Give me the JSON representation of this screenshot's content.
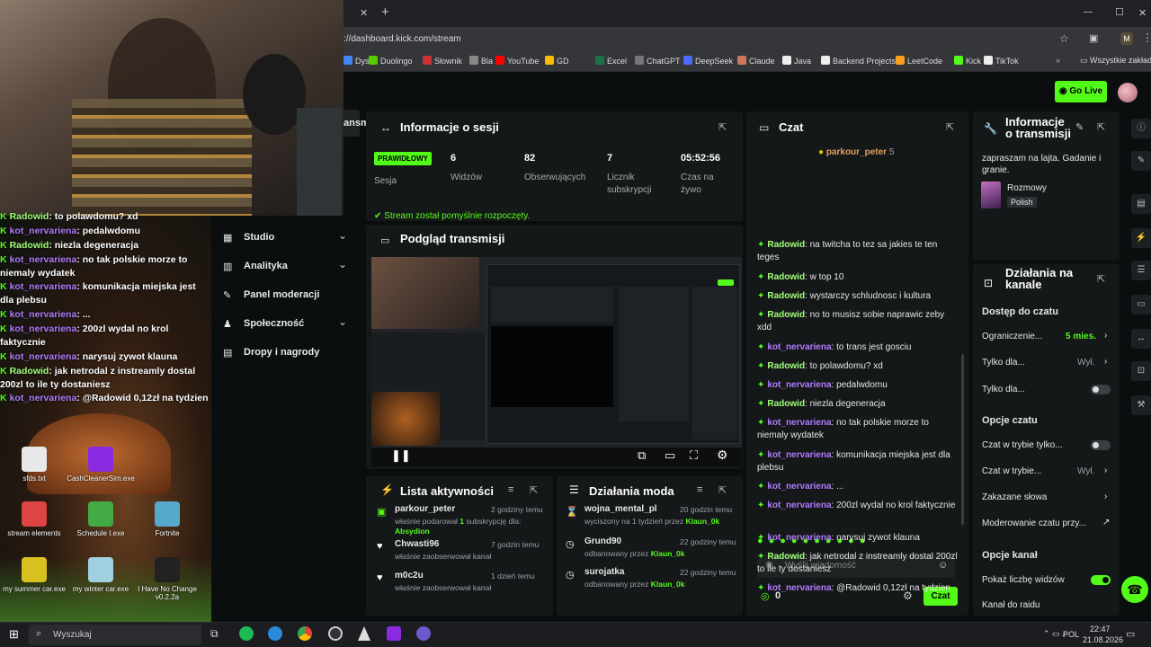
{
  "browser": {
    "close_tab": "✕",
    "new_tab": "+",
    "url": "://dashboard.kick.com/stream",
    "win_min": "—",
    "win_max": "☐",
    "win_close": "✕",
    "profile_initial": "M",
    "bookmarks": [
      "Dysk",
      "Duolingo",
      "Słownik",
      "Bla",
      "YouTube",
      "GD",
      "Excel",
      "ChatGPT",
      "DeepSeek",
      "Claude",
      "Java",
      "Backend Projects",
      "LeetCode",
      "Kick",
      "TikTok"
    ],
    "all_bookmarks": "Wszystkie zakładk"
  },
  "header": {
    "go_live": "Go Live"
  },
  "sidebar": {
    "partial_item": "ansmis",
    "items": [
      {
        "label": "Studio",
        "chev": "⌄"
      },
      {
        "label": "Analityka",
        "chev": "⌄"
      },
      {
        "label": "Panel moderacji",
        "chev": ""
      },
      {
        "label": "Społeczność",
        "chev": "⌄"
      },
      {
        "label": "Dropy i nagrody",
        "chev": ""
      }
    ]
  },
  "session": {
    "title": "Informacje o sesji",
    "badge": "PRAWIDŁOWY",
    "badge_label": "Sesja",
    "stats": [
      {
        "value": "6",
        "label": "Widzów"
      },
      {
        "value": "82",
        "label": "Obserwujących"
      },
      {
        "value": "7",
        "label": "Licznik subskrypcji"
      },
      {
        "value": "05:52:56",
        "label": "Czas na żywo"
      }
    ],
    "notice": "Stream został pomyślnie rozpoczęty."
  },
  "preview": {
    "title": "Podgląd transmisji"
  },
  "activity": {
    "title": "Lista aktywności",
    "items": [
      {
        "user": "parkour_peter",
        "time": "2 godziny temu",
        "desc": "właśnie podarował",
        "count": "1",
        "desc2": "subskrypcję dla:",
        "target": "Absydion"
      },
      {
        "user": "Chwasti96",
        "time": "7 godzin temu",
        "desc": "właśnie zaobserwował kanał"
      },
      {
        "user": "m0c2u",
        "time": "1 dzień temu",
        "desc": "właśnie zaobserwował kanał"
      }
    ]
  },
  "modactions": {
    "title": "Działania moda",
    "items": [
      {
        "user": "wojna_mental_pl",
        "time": "20 godzin temu",
        "desc": "wyciszony na 1 tydzień przez",
        "by": "Klaun_0k"
      },
      {
        "user": "Grund90",
        "time": "22 godziny temu",
        "desc": "odbanowany przez",
        "by": "Klaun_0k"
      },
      {
        "user": "surojatka",
        "time": "22 godziny temu",
        "desc": "odbanowany przez",
        "by": "Klaun_0k"
      }
    ]
  },
  "chat": {
    "title": "Czat",
    "pinned_user": "parkour_peter",
    "pinned_count": "5",
    "messages": [
      {
        "user": "Radowid",
        "text": ": na twitcha to tez sa jakies te ten teges"
      },
      {
        "user": "Radowid",
        "text": ": w top 10"
      },
      {
        "user": "Radowid",
        "text": ": wystarczy schludnosc i kultura"
      },
      {
        "user": "Radowid",
        "text": ": no to musisz sobie naprawic zeby xdd"
      },
      {
        "user": "kot_nervariena",
        "text": ": to trans jest gosciu"
      },
      {
        "user": "Radowid",
        "text": ": to polawdomu? xd"
      },
      {
        "user": "kot_nervariena",
        "text": ": pedalwdomu"
      },
      {
        "user": "Radowid",
        "text": ": niezla degeneracja"
      },
      {
        "user": "kot_nervariena",
        "text": ": no tak polskie morze to niemaly wydatek"
      },
      {
        "user": "kot_nervariena",
        "text": ": komunikacja miejska jest dla plebsu"
      },
      {
        "user": "kot_nervariena",
        "text": ": ..."
      },
      {
        "user": "kot_nervariena",
        "text": ": 200zl wydal no krol faktycznie"
      },
      {
        "user": "kot_nervariena",
        "text": ": narysuj zywot klauna"
      },
      {
        "user": "Radowid",
        "text": ": jak netrodal z instreamly dostal 200zl to ile ty dostaniesz"
      },
      {
        "user": "kot_nervariena",
        "text": ": @Radowid 0,12zł na tydzien"
      }
    ],
    "placeholder": "Wyślij wiadomość",
    "points": "0",
    "send": "Czat"
  },
  "stream_info": {
    "title_line1": "Informacje",
    "title_line2": "o transmisji",
    "stream_title": "zapraszam na lajta. Gadanie i granie.",
    "category": "Rozmowy",
    "language": "Polish"
  },
  "channel_actions": {
    "title_line1": "Działania na",
    "title_line2": "kanale",
    "chat_access": "Dostęp do czatu",
    "restriction": "Ograniczenie...",
    "restriction_value": "5 mies.",
    "only_for": "Tylko dla...",
    "only_for_value": "Wył.",
    "only_for2": "Tylko dla...",
    "chat_options": "Opcje czatu",
    "mode_only": "Czat w trybie tylko...",
    "mode": "Czat w trybie...",
    "mode_value": "Wył.",
    "banned_words": "Zakazane słowa",
    "moderation": "Moderowanie czatu przy...",
    "channel_options": "Opcje kanał",
    "show_viewers": "Pokaż liczbę widzów",
    "raid_channel": "Kanał do raidu"
  },
  "overlay_chat": [
    {
      "user": "Radowid",
      "text": "to polawdomu? xd"
    },
    {
      "user": "kot_nervariena",
      "text": "pedalwdomu"
    },
    {
      "user": "Radowid",
      "text": "niezla degeneracja"
    },
    {
      "user": "kot_nervariena",
      "text": "no tak polskie morze to niemaly wydatek"
    },
    {
      "user": "kot_nervariena",
      "text": "komunikacja miejska jest dla plebsu"
    },
    {
      "user": "kot_nervariena",
      "text": "..."
    },
    {
      "user": "kot_nervariena",
      "text": "200zl wydal no krol faktycznie"
    },
    {
      "user": "kot_nervariena",
      "text": "narysuj zywot klauna"
    },
    {
      "user": "Radowid",
      "text": "jak netrodal z instreamly dostal 200zl to ile ty dostaniesz"
    },
    {
      "user": "kot_nervariena",
      "text": "@Radowid 0,12zł na tydzien"
    }
  ],
  "desktop": {
    "icons": [
      "sfds.txt",
      "CashCleanerSim.exe",
      "stream elements",
      "Schedule I.exe",
      "Fortnite",
      "my summer car.exe",
      "my winter car.exe",
      "I Have No Change v0.2.2a"
    ]
  },
  "taskbar": {
    "search": "Wyszukaj",
    "lang": "POL",
    "time": "22:47",
    "date": "21.08.2026"
  },
  "colors": {
    "accent": "#53fc18",
    "panel": "#151819",
    "bg": "#0b0e0f",
    "username_purple": "#b07bff"
  }
}
